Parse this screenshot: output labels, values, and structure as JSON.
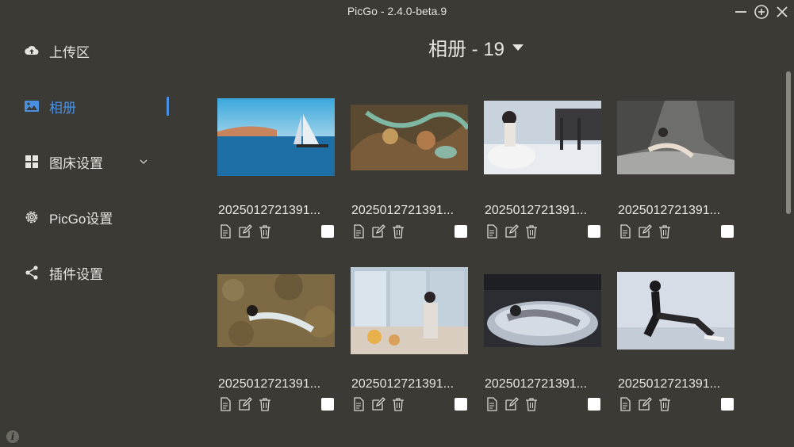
{
  "window": {
    "title": "PicGo - 2.4.0-beta.9"
  },
  "sidebar": {
    "items": [
      {
        "label": "上传区",
        "icon": "cloud-upload-icon"
      },
      {
        "label": "相册",
        "icon": "image-icon",
        "active": true
      },
      {
        "label": "图床设置",
        "icon": "grid-icon",
        "expandable": true
      },
      {
        "label": "PicGo设置",
        "icon": "gear-icon"
      },
      {
        "label": "插件设置",
        "icon": "share-icon"
      }
    ]
  },
  "album": {
    "title": "相册 - 19"
  },
  "gallery": {
    "items": [
      {
        "name": "2025012721391..."
      },
      {
        "name": "2025012721391..."
      },
      {
        "name": "2025012721391..."
      },
      {
        "name": "2025012721391..."
      },
      {
        "name": "2025012721391..."
      },
      {
        "name": "2025012721391..."
      },
      {
        "name": "2025012721391..."
      },
      {
        "name": "2025012721391..."
      }
    ]
  },
  "colors": {
    "accent": "#4a90e2",
    "background": "#3c3a35"
  }
}
